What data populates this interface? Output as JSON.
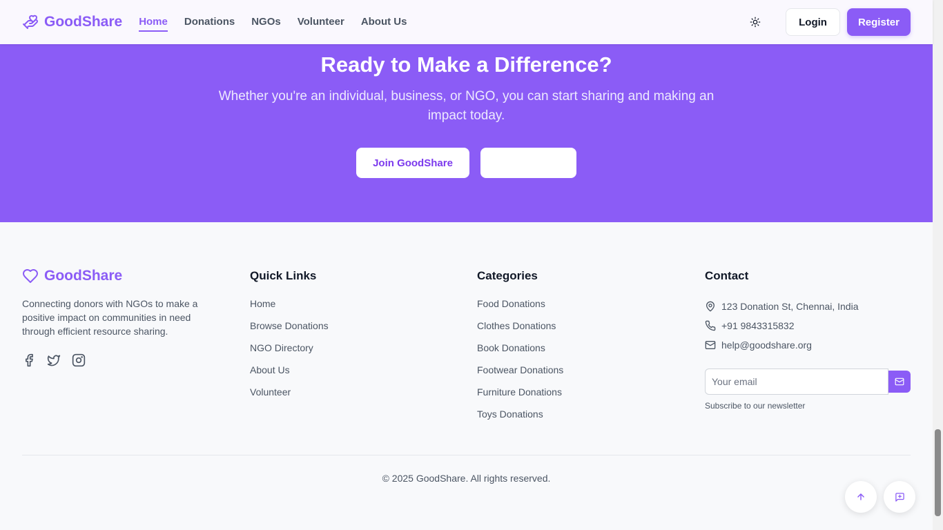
{
  "brand": {
    "name": "GoodShare"
  },
  "nav": [
    {
      "label": "Home",
      "active": true
    },
    {
      "label": "Donations"
    },
    {
      "label": "NGOs"
    },
    {
      "label": "Volunteer"
    },
    {
      "label": "About Us"
    }
  ],
  "header": {
    "theme_icon": "sun-icon",
    "login_label": "Login",
    "register_label": "Register"
  },
  "cta": {
    "title": "Ready to Make a Difference?",
    "subtitle": "Whether you're an individual, business, or NGO, you can start sharing and making an impact today.",
    "join_label": "Join GoodShare",
    "second_label": ""
  },
  "footer": {
    "brand_name": "GoodShare",
    "about": "Connecting donors with NGOs to make a positive impact on communities in need through efficient resource sharing.",
    "socials": [
      "facebook-icon",
      "twitter-icon",
      "instagram-icon"
    ],
    "quick_links": {
      "title": "Quick Links",
      "items": [
        "Home",
        "Browse Donations",
        "NGO Directory",
        "About Us",
        "Volunteer"
      ]
    },
    "categories": {
      "title": "Categories",
      "items": [
        "Food Donations",
        "Clothes Donations",
        "Book Donations",
        "Footwear Donations",
        "Furniture Donations",
        "Toys Donations"
      ]
    },
    "contact": {
      "title": "Contact",
      "address": "123 Donation St, Chennai, India",
      "phone": "+91 9843315832",
      "email": "help@goodshare.org",
      "email_placeholder": "Your email",
      "subscribe_note": "Subscribe to our newsletter"
    },
    "copyright": "© 2025 GoodShare. All rights reserved."
  },
  "colors": {
    "accent": "#8b5cf6",
    "background": "#f8f9fb"
  }
}
